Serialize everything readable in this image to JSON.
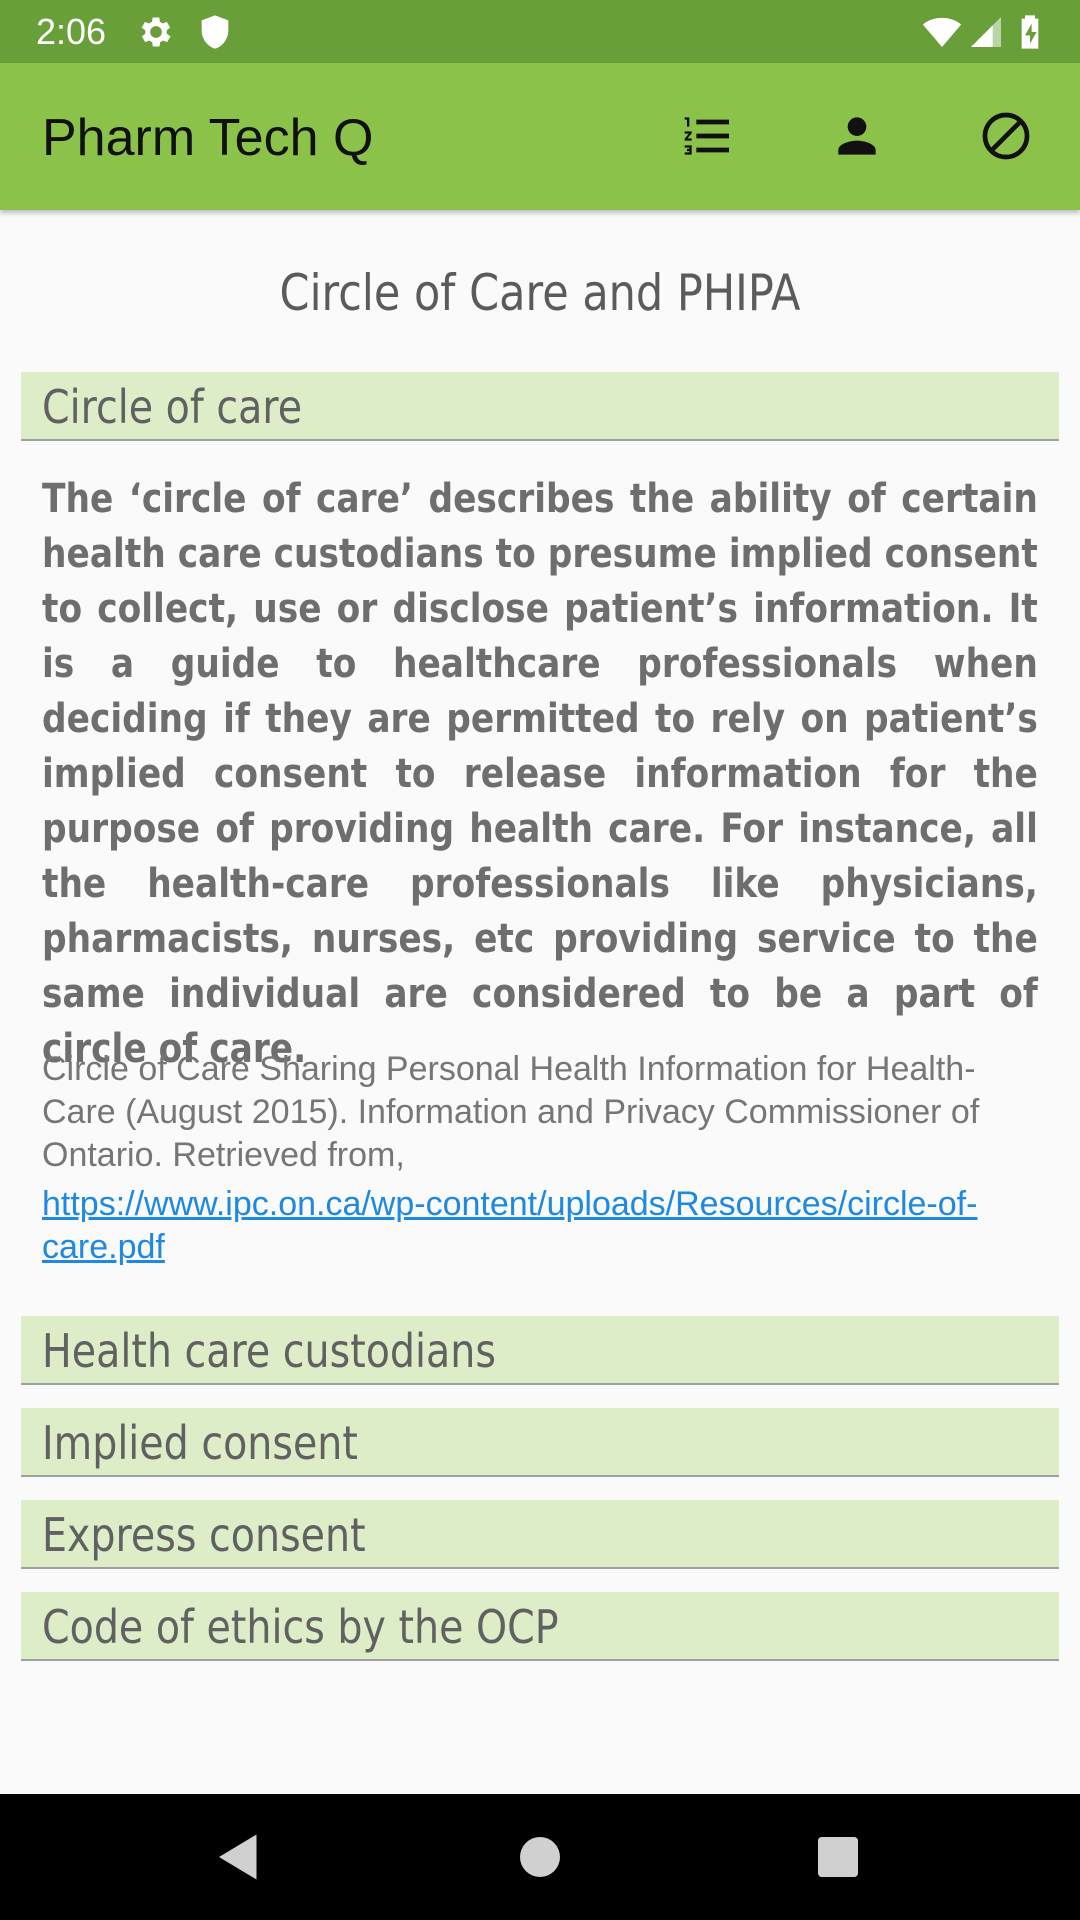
{
  "status_bar": {
    "time": "2:06",
    "icons": [
      "settings-gear-icon",
      "shield-icon",
      "wifi-icon",
      "signal-icon",
      "battery-charging-icon"
    ]
  },
  "app_bar": {
    "title": "Pharm Tech Q",
    "actions": [
      "numbered-list-icon",
      "person-icon",
      "block-icon"
    ]
  },
  "page": {
    "title": "Circle of Care and PHIPA"
  },
  "sections": [
    {
      "title": "Circle of care",
      "expanded": true,
      "body": "The ‘circle of care’ describes the ability of certain health care custodians to presume implied consent to collect, use or disclose patient’s information.  It is a guide to healthcare professionals when deciding if they are permitted to rely on patient’s implied consent to release information for the purpose of providing health care. For instance, all the health-care professionals like physicians, pharmacists, nurses, etc providing service to the same individual are considered to be a part of circle of care.",
      "citation": "Circle of Care Sharing Personal Health Information for Health-Care (August 2015). Information and Privacy Commissioner of Ontario. Retrieved from,",
      "link": "https://www.ipc.on.ca/wp-content/uploads/Resources/circle-of-care.pdf"
    },
    {
      "title": "Health care custodians",
      "expanded": false
    },
    {
      "title": "Implied consent",
      "expanded": false
    },
    {
      "title": "Express consent",
      "expanded": false
    },
    {
      "title": "Code of ethics by the OCP",
      "expanded": false
    }
  ],
  "nav_bar": {
    "buttons": [
      "back-icon",
      "home-icon",
      "recents-icon"
    ]
  },
  "colors": {
    "status_bar": "#689f38",
    "app_bar": "#8bc34a",
    "section_header": "#dcedc8",
    "link": "#1e88e5"
  }
}
